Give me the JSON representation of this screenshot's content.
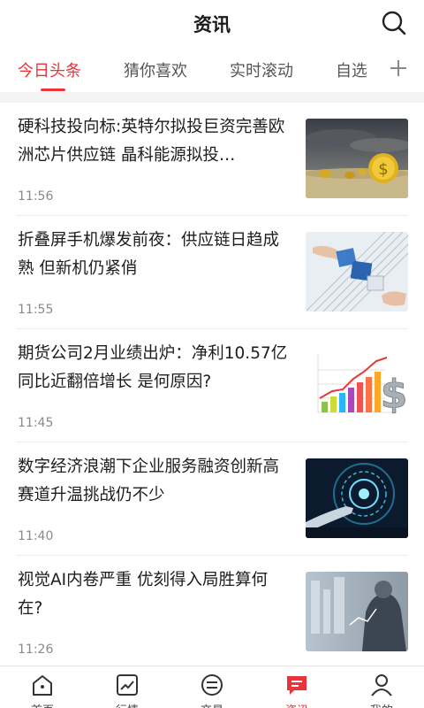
{
  "header": {
    "title": "资讯",
    "search_icon": "search-icon"
  },
  "tabs": [
    {
      "label": "今日头条",
      "active": true
    },
    {
      "label": "猜你喜欢",
      "active": false
    },
    {
      "label": "实时滚动",
      "active": false
    },
    {
      "label": "自选",
      "active": false
    }
  ],
  "tab_add_icon": "plus-icon",
  "news": [
    {
      "headline": "硬科技投向标:英特尔拟投巨资完善欧洲芯片供应链 晶科能源拟投…",
      "time": "11:56",
      "thumb": "coins-desert-image"
    },
    {
      "headline": "折叠屏手机爆发前夜：供应链日趋成熟 但新机仍紧俏",
      "time": "11:55",
      "thumb": "puzzle-hands-image"
    },
    {
      "headline": "期货公司2月业绩出炉：净利10.57亿同比近翻倍增长 是何原因?",
      "time": "11:45",
      "thumb": "growth-chart-dollar-image"
    },
    {
      "headline": "数字经济浪潮下企业服务融资创新高 赛道升温挑战仍不少",
      "time": "11:40",
      "thumb": "digital-hand-image"
    },
    {
      "headline": "视觉AI内卷严重 优刻得入局胜算何在?",
      "time": "11:26",
      "thumb": "business-ai-image"
    }
  ],
  "bottom_nav": [
    {
      "label": "首页",
      "icon": "home-icon",
      "active": false
    },
    {
      "label": "行情",
      "icon": "market-chart-icon",
      "active": false
    },
    {
      "label": "交易",
      "icon": "trade-exchange-icon",
      "active": false
    },
    {
      "label": "资讯",
      "icon": "news-icon",
      "active": true
    },
    {
      "label": "我的",
      "icon": "profile-icon",
      "active": false
    }
  ],
  "colors": {
    "accent": "#e8343a",
    "text": "#1d1d1d",
    "muted": "#8a8a8a"
  }
}
